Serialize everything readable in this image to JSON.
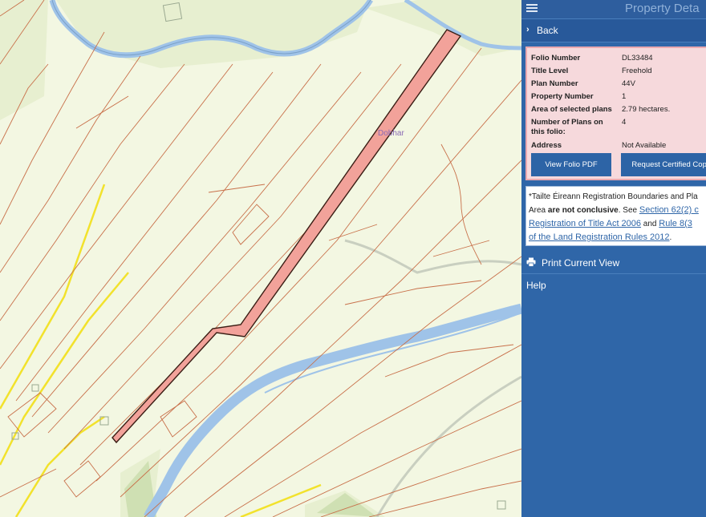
{
  "map": {
    "place_label": "Dobhar"
  },
  "panel": {
    "title": "Property Deta",
    "menu_icon": "hamburger-icon",
    "back_label": "Back",
    "details": [
      {
        "label": "Folio Number",
        "value": "DL33484"
      },
      {
        "label": "Title Level",
        "value": "Freehold"
      },
      {
        "label": "Plan Number",
        "value": "44V"
      },
      {
        "label": "Property Number",
        "value": "1"
      },
      {
        "label": "Area of selected plans",
        "value": "2.79 hectares."
      },
      {
        "label": "Number of Plans on this folio:",
        "value": "4"
      },
      {
        "label": "Address",
        "value": "Not Available"
      }
    ],
    "view_pdf_label": "View Folio PDF",
    "request_copy_label": "Request Certified Copy",
    "note": {
      "line1": "*Tailte Éireann Registration Boundaries and Pla",
      "line2_a": "Area ",
      "line2_b": "are not conclusive",
      "line2_c": ". See ",
      "link1a": "Section 62(2) c",
      "link1b": "Registration of Title Act 2006",
      "and": " and ",
      "link2a": "Rule 8(3",
      "link2b": "of the Land Registration Rules 2012",
      "period": "."
    },
    "print_label": "Print Current View",
    "print_icon": "printer-icon",
    "help_label": "Help"
  },
  "colors": {
    "panel_bg": "#2f66a8",
    "card_bg": "#f6d9dc",
    "selected_parcel": "#f2a29a",
    "river": "#b7d3ee",
    "boundary": "#c8704a",
    "road_yellow": "#f2e22c",
    "map_bg": "#f3f7e2"
  }
}
